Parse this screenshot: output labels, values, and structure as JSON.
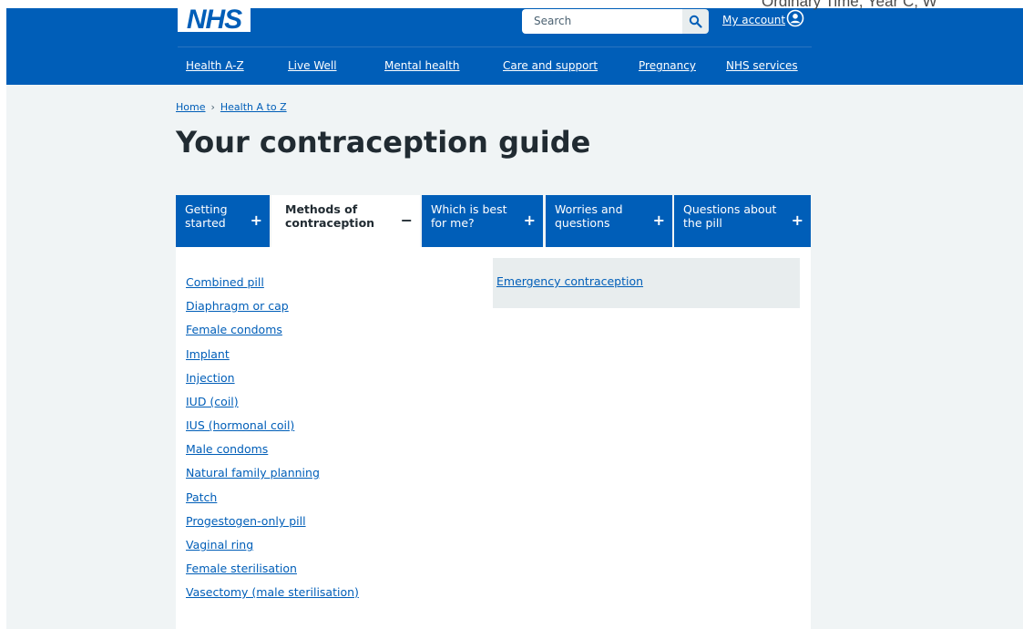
{
  "header": {
    "logo_text": "NHS",
    "search": {
      "placeholder": "Search"
    },
    "account_label": "My account",
    "corner_text": "Ordinary Time, Year C, W",
    "nav": [
      {
        "label": "Health A-Z"
      },
      {
        "label": "Live Well"
      },
      {
        "label": "Mental health"
      },
      {
        "label": "Care and support"
      },
      {
        "label": "Pregnancy"
      },
      {
        "label": "NHS services"
      }
    ]
  },
  "breadcrumb": [
    {
      "label": "Home"
    },
    {
      "label": "Health A to Z"
    }
  ],
  "breadcrumb_separator": "›",
  "page_title": "Your contraception guide",
  "tabs": [
    {
      "label": "Getting started",
      "icon": "+",
      "active": false
    },
    {
      "label": "Methods of contraception",
      "icon": "−",
      "active": true
    },
    {
      "label": "Which is best for me?",
      "icon": "+",
      "active": false
    },
    {
      "label": "Worries and questions",
      "icon": "+",
      "active": false
    },
    {
      "label": "Questions about the pill",
      "icon": "+",
      "active": false
    }
  ],
  "methods": [
    {
      "label": "Combined pill"
    },
    {
      "label": "Diaphragm or cap"
    },
    {
      "label": "Female condoms"
    },
    {
      "label": "Implant"
    },
    {
      "label": "Injection"
    },
    {
      "label": "IUD (coil)"
    },
    {
      "label": "IUS (hormonal coil)"
    },
    {
      "label": "Male condoms"
    },
    {
      "label": "Natural family planning"
    },
    {
      "label": "Patch"
    },
    {
      "label": "Progestogen-only pill"
    },
    {
      "label": "Vaginal ring"
    },
    {
      "label": "Female sterilisation"
    },
    {
      "label": "Vasectomy (male sterilisation)"
    }
  ],
  "emergency_link": "Emergency contraception",
  "colors": {
    "nhs_blue": "#005eb8",
    "page_background": "#f0f4f5",
    "text": "#212b32",
    "panel_grey": "#e8edee"
  }
}
